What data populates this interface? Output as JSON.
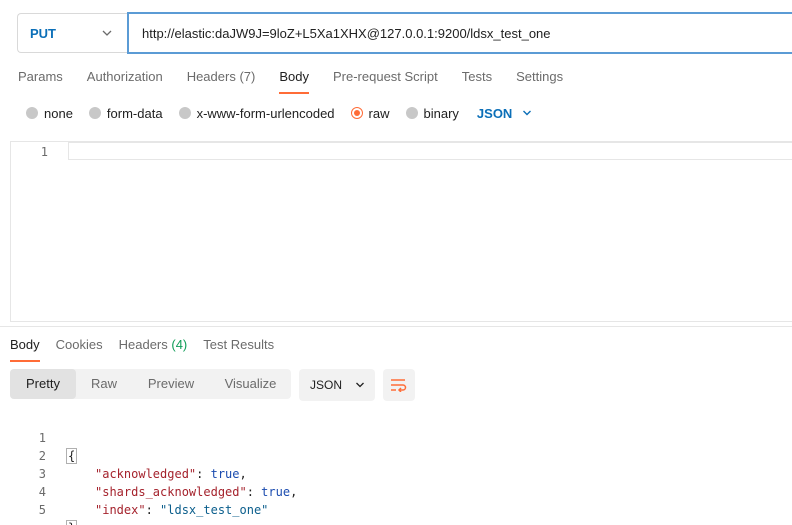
{
  "request": {
    "method": "PUT",
    "url": "http://elastic:daJW9J=9loZ+L5Xa1XHX@127.0.0.1:9200/ldsx_test_one"
  },
  "request_tabs": [
    {
      "label": "Params",
      "count": ""
    },
    {
      "label": "Authorization",
      "count": ""
    },
    {
      "label": "Headers",
      "count": "(7)"
    },
    {
      "label": "Body",
      "count": "",
      "active": true
    },
    {
      "label": "Pre-request Script",
      "count": ""
    },
    {
      "label": "Tests",
      "count": ""
    },
    {
      "label": "Settings",
      "count": ""
    }
  ],
  "body_types": {
    "options": [
      "none",
      "form-data",
      "x-www-form-urlencoded",
      "raw",
      "binary"
    ],
    "selected": "raw",
    "format": "JSON"
  },
  "editor": {
    "line_numbers": [
      "1"
    ]
  },
  "response_tabs": [
    {
      "label": "Body",
      "count": "",
      "active": true
    },
    {
      "label": "Cookies",
      "count": ""
    },
    {
      "label": "Headers",
      "count": "(4)"
    },
    {
      "label": "Test Results",
      "count": ""
    }
  ],
  "response_views": {
    "options": [
      "Pretty",
      "Raw",
      "Preview",
      "Visualize"
    ],
    "selected": "Pretty",
    "format": "JSON"
  },
  "response_body": {
    "line_numbers": [
      "1",
      "2",
      "3",
      "4",
      "5"
    ],
    "open_brace": "{",
    "close_brace": "}",
    "entries": [
      {
        "key": "\"acknowledged\"",
        "value": "true",
        "type": "bool",
        "trail": ","
      },
      {
        "key": "\"shards_acknowledged\"",
        "value": "true",
        "type": "bool",
        "trail": ","
      },
      {
        "key": "\"index\"",
        "value": "\"ldsx_test_one\"",
        "type": "string",
        "trail": ""
      }
    ]
  },
  "colors": {
    "accent": "#ff6c37",
    "method": "#0b6fb8",
    "count_green": "#0f9d58",
    "url_border": "#5b9bd5"
  }
}
